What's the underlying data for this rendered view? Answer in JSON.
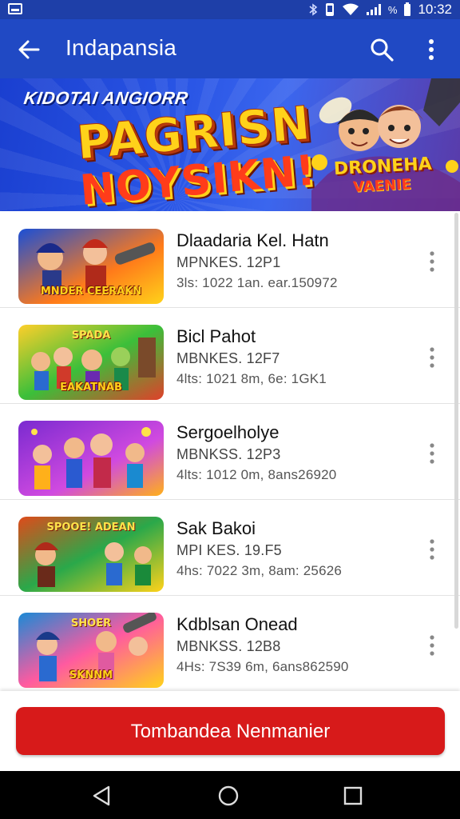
{
  "status_bar": {
    "time": "10:32",
    "battery_text": "%",
    "icons": [
      "notification-icon",
      "bluetooth-icon",
      "vibrate-icon",
      "wifi-icon",
      "signal-icon",
      "battery-icon"
    ]
  },
  "app_bar": {
    "title": "Indapansia",
    "back_icon": "arrow-left-icon",
    "search_icon": "search-icon",
    "more_icon": "more-vertical-icon"
  },
  "banner": {
    "kicker": "KIDOTAI ANGIORR",
    "headline_line1": "PAGRISN",
    "headline_line2": "NOYSIKN!",
    "badge_line1": "DRONEHA",
    "badge_line2": "VAENIE"
  },
  "games": [
    {
      "name": "Dlaadaria Kel. Hatn",
      "line1": "MPNKES. 12P1",
      "line2": "3ls: 1022 1an.   ear.150972",
      "thumb_caption": "MNDER CEERAKN",
      "colors": [
        "#1a4fd6",
        "#ff7a1a",
        "#ffd21a"
      ]
    },
    {
      "name": "Bicl Pahot",
      "line1": "MBNKES. 12F7",
      "line2": "4lts: 1021 8m,   6e: 1GK1",
      "thumb_caption_top": "SPADA",
      "thumb_caption": "EAKATNAB",
      "colors": [
        "#3bbf3a",
        "#ffcf2a",
        "#e0402a"
      ]
    },
    {
      "name": "Sergoelholye",
      "line1": "MBNKSS. 12P3",
      "line2": "4lts: 1012 0m,   8ans26920",
      "thumb_caption": "",
      "colors": [
        "#7a2ad0",
        "#d04ae0",
        "#ffb01a"
      ]
    },
    {
      "name": "Sak Bakoi",
      "line1": "MPI KES. 19.F5",
      "line2": "4hs: 7022 3m,   8am: 25626",
      "thumb_caption_top": "SPOOE! ADEAN",
      "thumb_caption": "",
      "colors": [
        "#2aa84a",
        "#ffd21a",
        "#e04a1a"
      ]
    },
    {
      "name": "Kdblsan Onead",
      "line1": "MBNKSS. 12B8",
      "line2": "4Hs: 7S39 6m,   6ans862590",
      "thumb_caption_top": "SHOER",
      "thumb_caption": "SKNNM",
      "colors": [
        "#1a8ad6",
        "#ff5aa0",
        "#ffd21a"
      ]
    }
  ],
  "item_menu_icon": "more-vertical-icon",
  "cta": {
    "label": "Tombandea Nenmanier",
    "color": "#d71a1a"
  },
  "nav_bar": {
    "icons": [
      "back-triangle-icon",
      "home-circle-icon",
      "recents-square-icon"
    ]
  },
  "colors": {
    "app_bar": "#2049c4",
    "status_bar": "#1e3fa8"
  }
}
